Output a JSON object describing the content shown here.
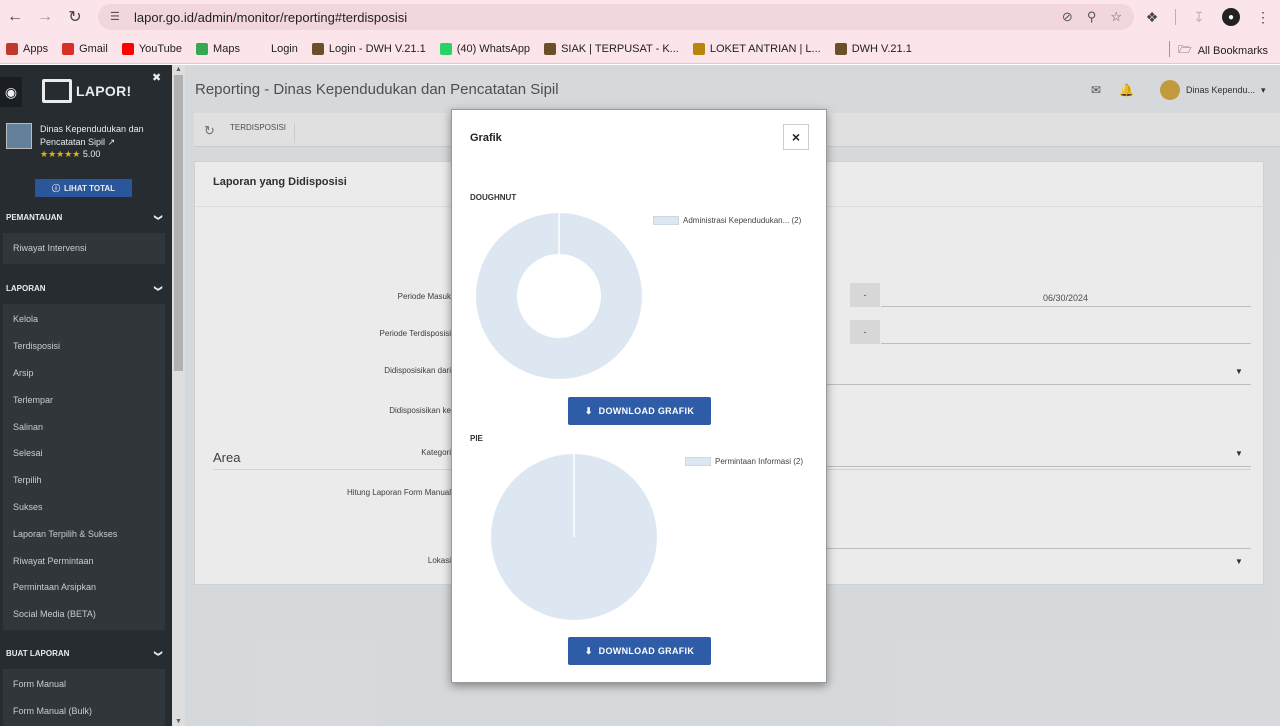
{
  "browser": {
    "url": "lapor.go.id/admin/monitor/reporting#terdisposisi",
    "bookmarks": [
      {
        "label": "Apps",
        "icon": "apps-grid-icon",
        "color": "#c0392b"
      },
      {
        "label": "Gmail",
        "icon": "gmail-icon",
        "color": "#d93025"
      },
      {
        "label": "YouTube",
        "icon": "youtube-icon",
        "color": "#ff0000"
      },
      {
        "label": "Maps",
        "icon": "maps-icon",
        "color": "#34a853"
      },
      {
        "label": "Login",
        "icon": "blank-icon",
        "color": "#fbe4ea"
      },
      {
        "label": "Login - DWH V.21.1",
        "icon": "dwh-icon",
        "color": "#6b4f2a"
      },
      {
        "label": "(40) WhatsApp",
        "icon": "whatsapp-icon",
        "color": "#25d366"
      },
      {
        "label": "SIAK | TERPUSAT - K...",
        "icon": "siak-icon",
        "color": "#6b4f2a"
      },
      {
        "label": "LOKET ANTRIAN | L...",
        "icon": "loket-icon",
        "color": "#b8860b"
      },
      {
        "label": "DWH V.21.1",
        "icon": "dwh-icon",
        "color": "#6b4f2a"
      }
    ],
    "all_bookmarks": "All Bookmarks"
  },
  "sidebar": {
    "logo": "LAPOR!",
    "org_name": "Dinas Kependudukan dan Pencatatan Sipil",
    "rating": "5.00",
    "lihat_total": "LIHAT TOTAL",
    "sections": [
      {
        "title": "PEMANTAUAN",
        "items": [
          "Riwayat Intervensi"
        ]
      },
      {
        "title": "LAPORAN",
        "items": [
          "Kelola",
          "Terdisposisi",
          "Arsip",
          "Terlempar",
          "Salinan",
          "Selesai",
          "Terpilih",
          "Sukses",
          "Laporan Terpilih & Sukses",
          "Riwayat Permintaan",
          "Permintaan Arsipkan",
          "Social Media (BETA)"
        ]
      },
      {
        "title": "BUAT LAPORAN",
        "items": [
          "Form Manual",
          "Form Manual (Bulk)"
        ]
      }
    ]
  },
  "main": {
    "title": "Reporting - Dinas Kependudukan dan Pencatatan Sipil",
    "user": "Dinas Kependu...",
    "tab": "TERDISPOSISI",
    "panel_title": "Laporan yang Didisposisi",
    "form_labels": [
      "Periode Masuk",
      "Periode Terdisposisi",
      "Didisposisikan dari",
      "Didisposisikan ke",
      "Kategori",
      "Hitung Laporan Form Manual",
      "Lokasi"
    ],
    "dash": "-",
    "date_end": "06/30/2024",
    "area": "Area"
  },
  "modal": {
    "title": "Grafik",
    "close": "×",
    "download_label": "DOWNLOAD GRAFIK",
    "charts": [
      {
        "label": "DOUGHNUT",
        "legend": "Administrasi Kependudukan... (2)"
      },
      {
        "label": "PIE",
        "legend": "Permintaan Informasi (2)"
      }
    ]
  },
  "chart_data": [
    {
      "type": "pie",
      "variant": "doughnut",
      "categories": [
        "Administrasi Kependudukan..."
      ],
      "values": [
        2
      ],
      "title": "DOUGHNUT",
      "legend_position": "top-right",
      "color": "#dde7f2"
    },
    {
      "type": "pie",
      "categories": [
        "Permintaan Informasi"
      ],
      "values": [
        2
      ],
      "title": "PIE",
      "legend_position": "top-right",
      "color": "#dde7f2"
    }
  ],
  "colors": {
    "accent": "#2e5ca6",
    "sidebar": "#2b3035",
    "chrome": "#fbe4ea",
    "slice": "#dde7f2"
  }
}
